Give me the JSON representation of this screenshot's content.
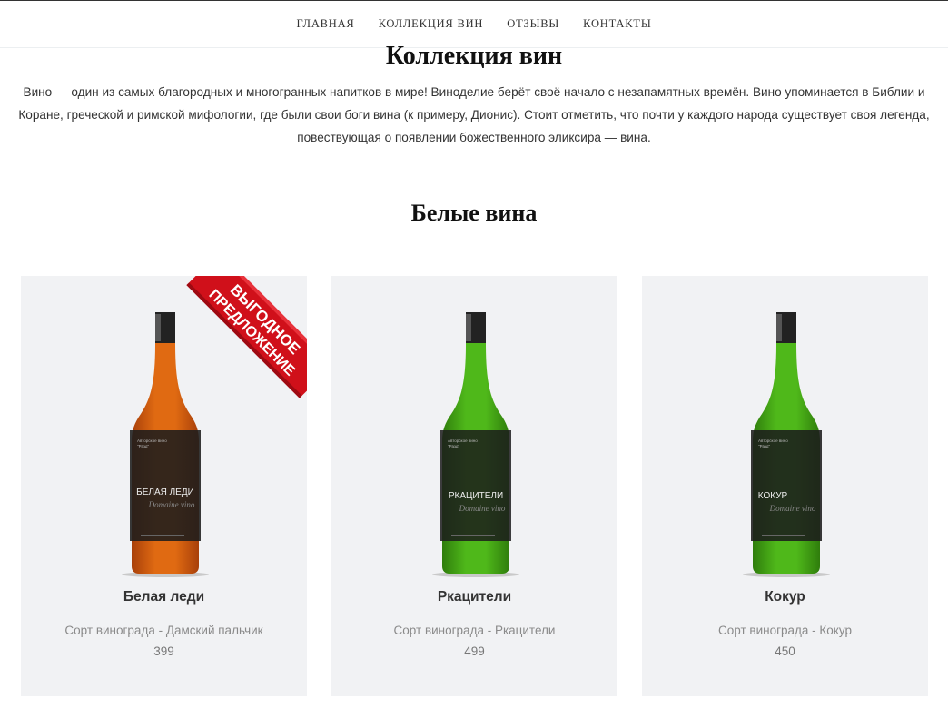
{
  "nav": {
    "items": [
      "ГЛАВНАЯ",
      "КОЛЛЕКЦИЯ ВИН",
      "ОТЗЫВЫ",
      "КОНТАКТЫ"
    ]
  },
  "page": {
    "title": "Коллекция вин",
    "intro": "Вино — один из самых благородных и многогранных напитков в мире! Виноделие берёт своё начало с незапамятных времён. Вино упоминается в Библии и Коране, греческой и римской мифологии, где были свои боги вина (к примеру, Дионис). Стоит отметить, что почти у каждого народа существует своя легенда, повествующая о появлении божественного эликсира — вина."
  },
  "section": {
    "title": "Белые вина"
  },
  "badge": {
    "line1": "ВЫГОДНОЕ",
    "line2": "ПРЕДЛОЖЕНИЕ"
  },
  "products": [
    {
      "name": "Белая леди",
      "variety": "Сорт винограда - Дамский пальчик",
      "price": "399",
      "label_top": "Авторское вино",
      "label_brand": "\"Разд\"",
      "label_title": "БЕЛАЯ ЛЕДИ",
      "label_script": "Domaine vino",
      "bottle_color": "#e06a12",
      "bottle_dark": "#a8400a"
    },
    {
      "name": "Ркацители",
      "variety": "Сорт винограда - Ркацители",
      "price": "499",
      "label_top": "Авторское вино",
      "label_brand": "\"Разд\"",
      "label_title": "РКАЦИТЕЛИ",
      "label_script": "Domaine vino",
      "bottle_color": "#4fb81a",
      "bottle_dark": "#2f7d0c"
    },
    {
      "name": "Кокур",
      "variety": "Сорт винограда - Кокур",
      "price": "450",
      "label_top": "Авторское вино",
      "label_brand": "\"Разд\"",
      "label_title": "КОКУР",
      "label_script": "Domaine vino",
      "bottle_color": "#4fb81a",
      "bottle_dark": "#2f7d0c"
    }
  ],
  "colors": {
    "ribbon": "#d0101a",
    "card_bg": "#f1f2f4"
  }
}
